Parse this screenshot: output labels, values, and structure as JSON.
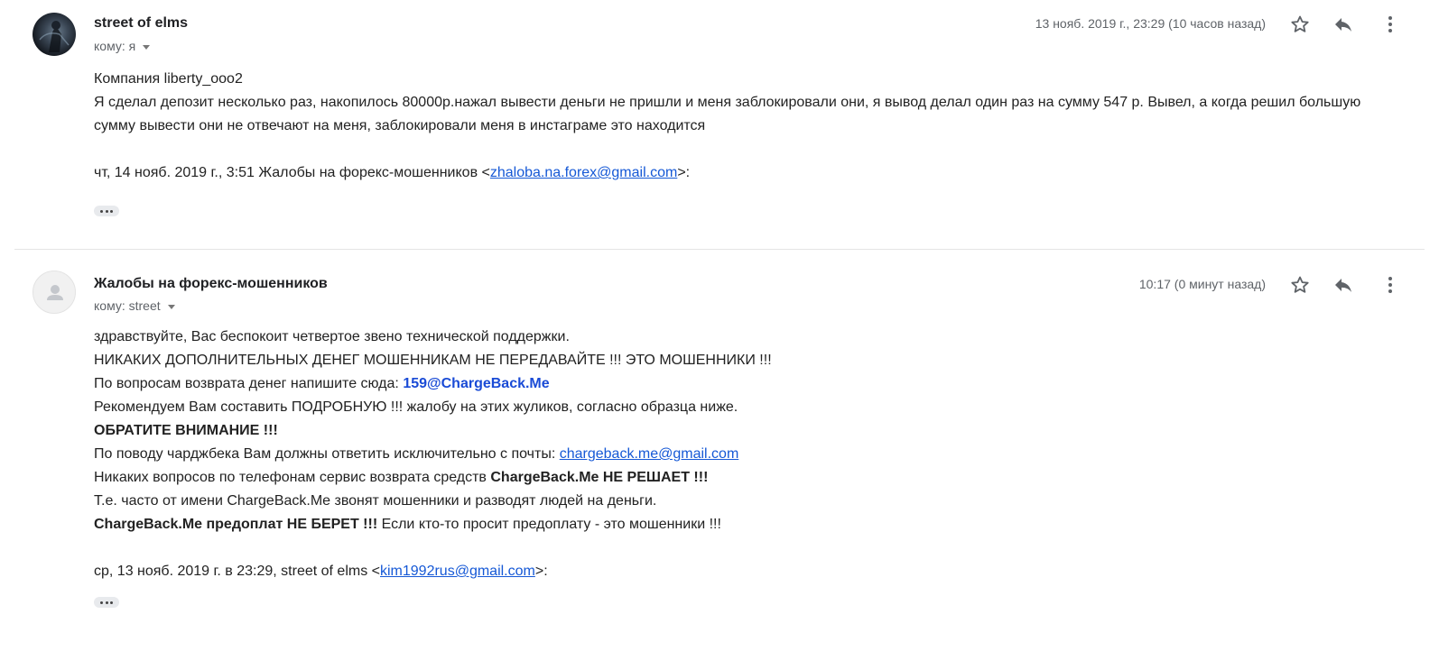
{
  "messages": [
    {
      "sender": "street of elms",
      "to_label": "кому: я",
      "date": "13 нояб. 2019 г., 23:29 (10 часов назад)",
      "body": {
        "line1": "Компания liberty_ooo2",
        "line2": "Я сделал депозит несколько раз, накопилось 80000р.нажал вывести деньги не пришли и меня заблокировали они, я вывод делал один раз на сумму 547 р. Вывел, а когда решил большую сумму вывести они не отвечают на меня, заблокировали меня в инстаграме это находится",
        "quote_prefix": "чт, 14 нояб. 2019 г., 3:51 Жалобы на форекс-мошенников <",
        "quote_email": "zhaloba.na.forex@gmail.com",
        "quote_suffix": ">:"
      }
    },
    {
      "sender": "Жалобы на форекс-мошенников",
      "to_label": "кому: street",
      "date": "10:17 (0 минут назад)",
      "body": {
        "l1": "здравствуйте, Вас беспокоит четвертое звено технической поддержки.",
        "l2": "НИКАКИХ ДОПОЛНИТЕЛЬНЫХ ДЕНЕГ МОШЕННИКАМ НЕ ПЕРЕДАВАЙТЕ !!! ЭТО МОШЕННИКИ !!!",
        "l3_prefix": "По вопросам возврата денег напишите сюда: ",
        "l3_highlight": "159@ChargeBack.Me",
        "l4": "Рекомендуем Вам составить ПОДРОБНУЮ !!! жалобу на этих жуликов, согласно образца ниже.",
        "l5": "ОБРАТИТЕ ВНИМАНИЕ !!!",
        "l6_prefix": "По поводу чарджбека Вам должны ответить исключительно с почты: ",
        "l6_email": "chargeback.me@gmail.com",
        "l7_prefix": "Никаких вопросов по телефонам сервис возврата средств ",
        "l7_bold": "ChargeBack.Me НЕ РЕШАЕТ !!!",
        "l8": "Т.е. часто от имени ChargeBack.Me звонят мошенники и разводят людей на деньги.",
        "l9_bold": "ChargeBack.Me предоплат НЕ БЕРЕТ !!!",
        "l9_suffix": " Если кто-то просит предоплату - это мошенники !!!",
        "quote_prefix": "ср, 13 нояб. 2019 г. в 23:29, street of elms <",
        "quote_email": "kim1992rus@gmail.com",
        "quote_suffix": ">:"
      }
    }
  ],
  "icons": {
    "star": "star-icon",
    "reply": "reply-icon",
    "more": "more-vert-icon",
    "expand": "ellipsis-icon",
    "avatar_default": "person-icon"
  },
  "colors": {
    "link": "#1558d6",
    "highlight": "#1a4bd6",
    "meta_text": "#5f6368"
  }
}
